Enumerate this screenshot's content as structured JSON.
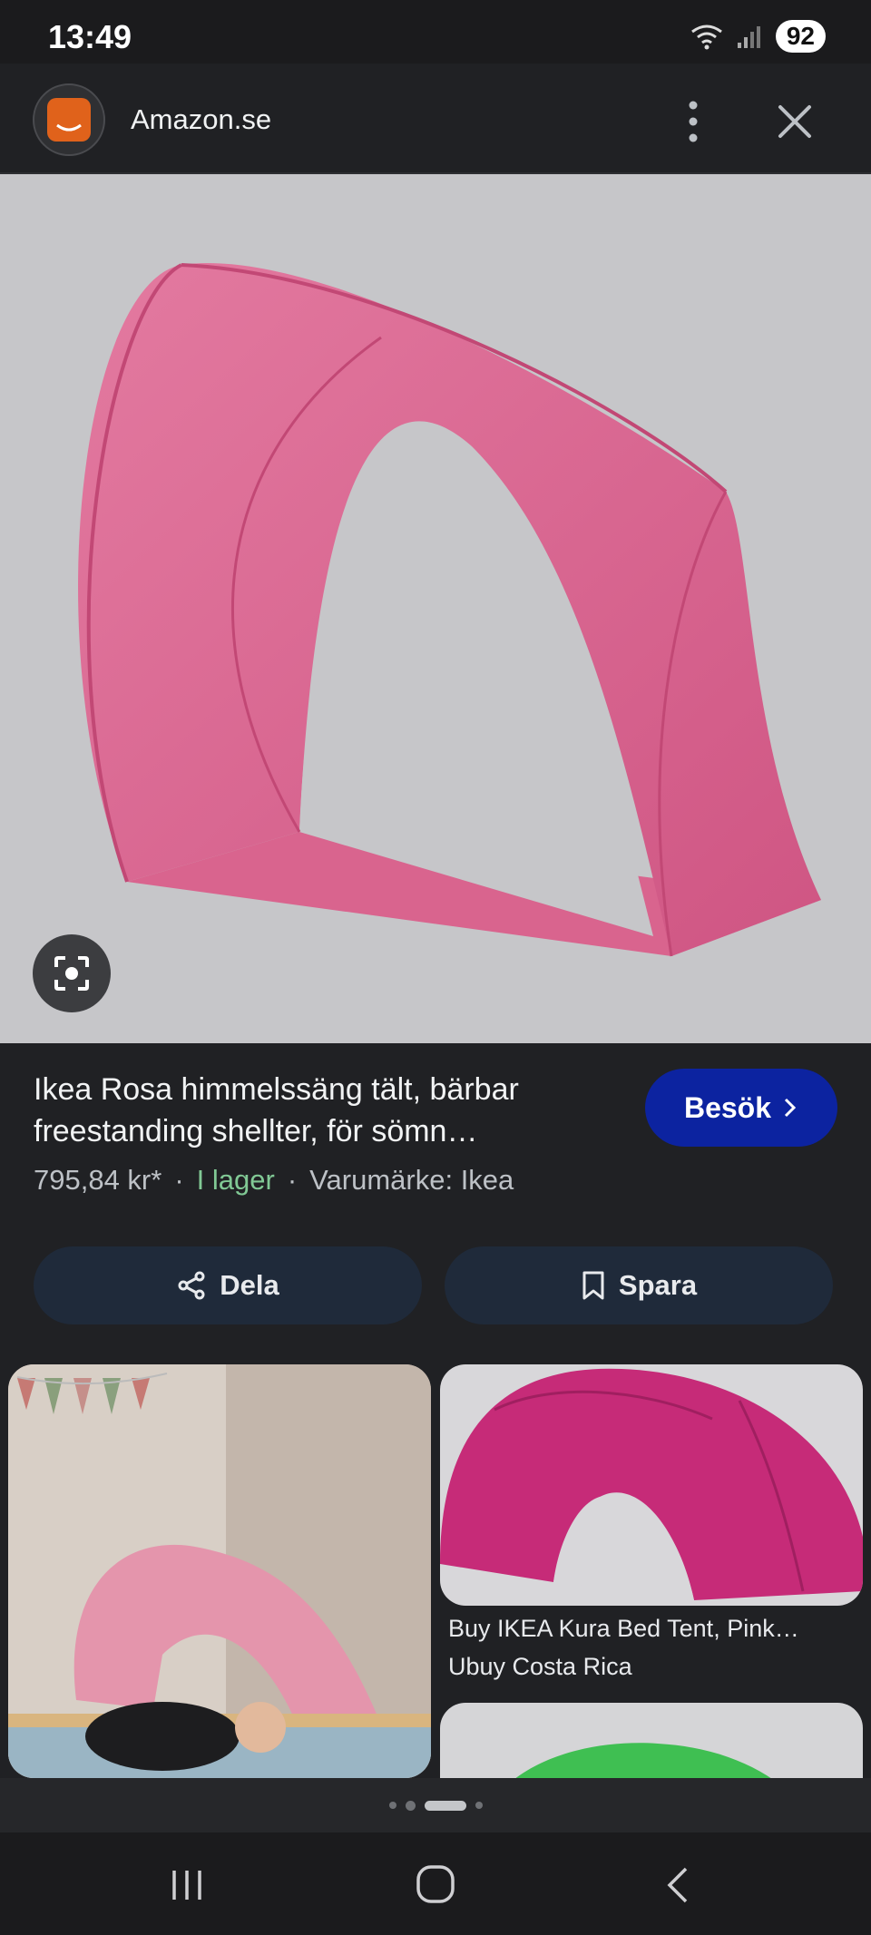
{
  "status_bar": {
    "time": "13:49",
    "battery": "92"
  },
  "header": {
    "site_name": "Amazon.se"
  },
  "product": {
    "title": "Ikea Rosa himmelssäng tält, bärbar freestanding shellter, för sömn…",
    "price": "795,84 kr*",
    "stock": "I lager",
    "brand": "Varumärke: Ikea",
    "separator": "·",
    "visit_label": "Besök"
  },
  "actions": {
    "share_label": "Dela",
    "save_label": "Spara"
  },
  "related": [
    {
      "title": "Buy IKEA Kura Bed Tent, Pink…",
      "source": "Ubuy Costa Rica"
    }
  ],
  "colors": {
    "accent_button": "#0c23a0",
    "in_stock": "#81c995",
    "background": "#202124"
  },
  "icons": [
    "wifi-icon",
    "signal-icon",
    "more-vert-icon",
    "close-icon",
    "lens-icon",
    "chevron-right-icon",
    "share-icon",
    "bookmark-icon",
    "recents-icon",
    "home-icon",
    "back-icon"
  ]
}
